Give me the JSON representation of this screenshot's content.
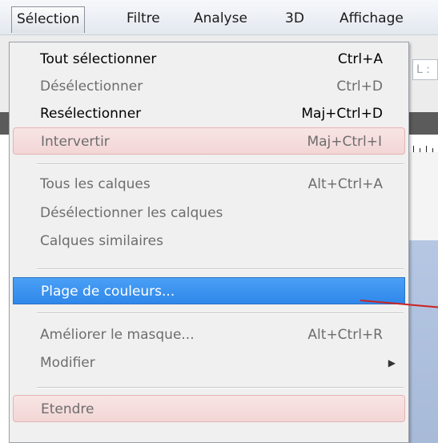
{
  "menubar": {
    "items": [
      {
        "label": "Sélection",
        "active": true
      },
      {
        "label": "Filtre"
      },
      {
        "label": "Analyse"
      },
      {
        "label": "3D"
      },
      {
        "label": "Affichage"
      }
    ]
  },
  "background": {
    "field_text": "L :"
  },
  "menu": {
    "items": [
      {
        "label": "Tout sélectionner",
        "shortcut": "Ctrl+A",
        "state": "enabled"
      },
      {
        "label": "Désélectionner",
        "shortcut": "Ctrl+D",
        "state": "disabled"
      },
      {
        "label": "Resélectionner",
        "shortcut": "Maj+Ctrl+D",
        "state": "enabled"
      },
      {
        "label": "Intervertir",
        "shortcut": "Maj+Ctrl+I",
        "state": "disabled",
        "flagged": true
      },
      {
        "label": "Tous les calques",
        "shortcut": "Alt+Ctrl+A",
        "state": "disabled"
      },
      {
        "label": "Désélectionner les calques",
        "shortcut": "",
        "state": "disabled"
      },
      {
        "label": "Calques similaires",
        "shortcut": "",
        "state": "disabled"
      },
      {
        "label": "Plage de couleurs...",
        "shortcut": "",
        "state": "highlighted"
      },
      {
        "label": "Améliorer le masque...",
        "shortcut": "Alt+Ctrl+R",
        "state": "disabled"
      },
      {
        "label": "Modifier",
        "shortcut": "",
        "state": "disabled",
        "submenu": true
      },
      {
        "label": "Etendre",
        "shortcut": "",
        "state": "disabled",
        "flagged": true
      }
    ]
  },
  "colors": {
    "highlight": "#2f87ea",
    "flag": "#f3d6d6",
    "pointer": "#cc2222"
  }
}
